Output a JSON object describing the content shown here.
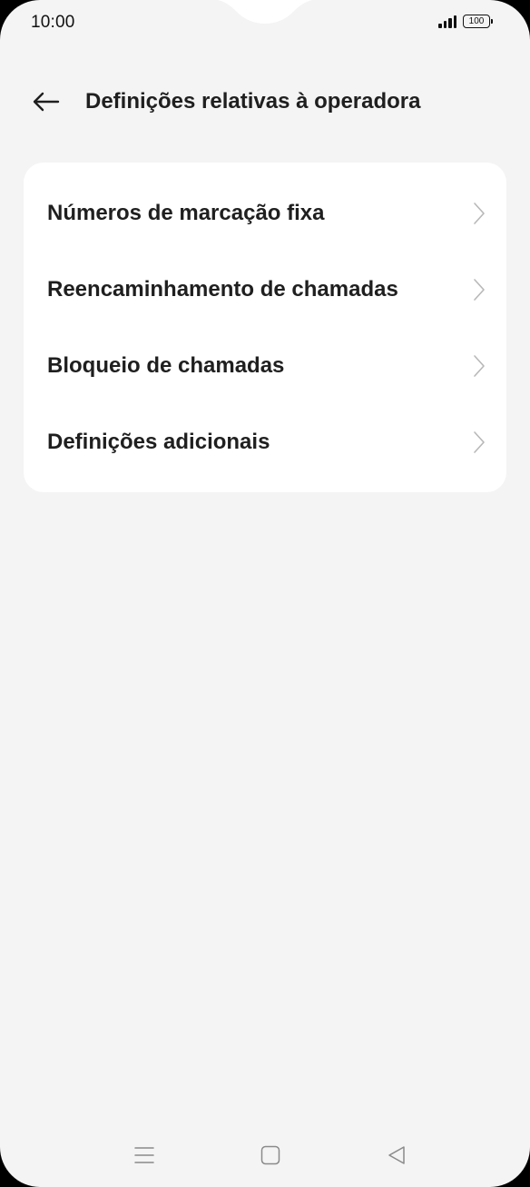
{
  "status_bar": {
    "time": "10:00",
    "battery_level": "100",
    "icons": [
      "signal-icon",
      "battery-icon"
    ]
  },
  "header": {
    "back_icon": "arrow-left-icon",
    "title": "Definições relativas à operadora"
  },
  "menu": {
    "items": [
      {
        "label": "Números de marcação fixa",
        "icon": "chevron-right-icon"
      },
      {
        "label": "Reencaminhamento de chamadas",
        "icon": "chevron-right-icon"
      },
      {
        "label": "Bloqueio de chamadas",
        "icon": "chevron-right-icon"
      },
      {
        "label": "Definições adicionais",
        "icon": "chevron-right-icon"
      }
    ]
  },
  "nav_bar": {
    "buttons": [
      "menu-icon",
      "home-icon",
      "back-triangle-icon"
    ]
  },
  "colors": {
    "background": "#f4f4f4",
    "card": "#ffffff",
    "text": "#1f1f1f",
    "chevron": "#b8b8b8"
  }
}
